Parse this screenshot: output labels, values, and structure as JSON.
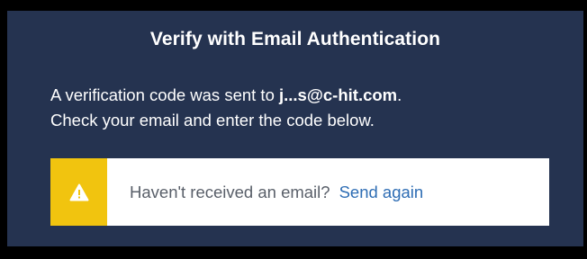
{
  "dialog": {
    "title": "Verify with Email Authentication",
    "message_prefix": "A verification code was sent to ",
    "email": "j...s@c-hit.com",
    "message_suffix": ".",
    "message_line2": "Check your email and enter the code below."
  },
  "notice": {
    "icon": "warning-icon",
    "text": "Haven't received an email?",
    "link_label": "Send again"
  },
  "colors": {
    "panel_bg": "#253350",
    "warning_accent": "#f1c40f",
    "link": "#2e6db4"
  }
}
